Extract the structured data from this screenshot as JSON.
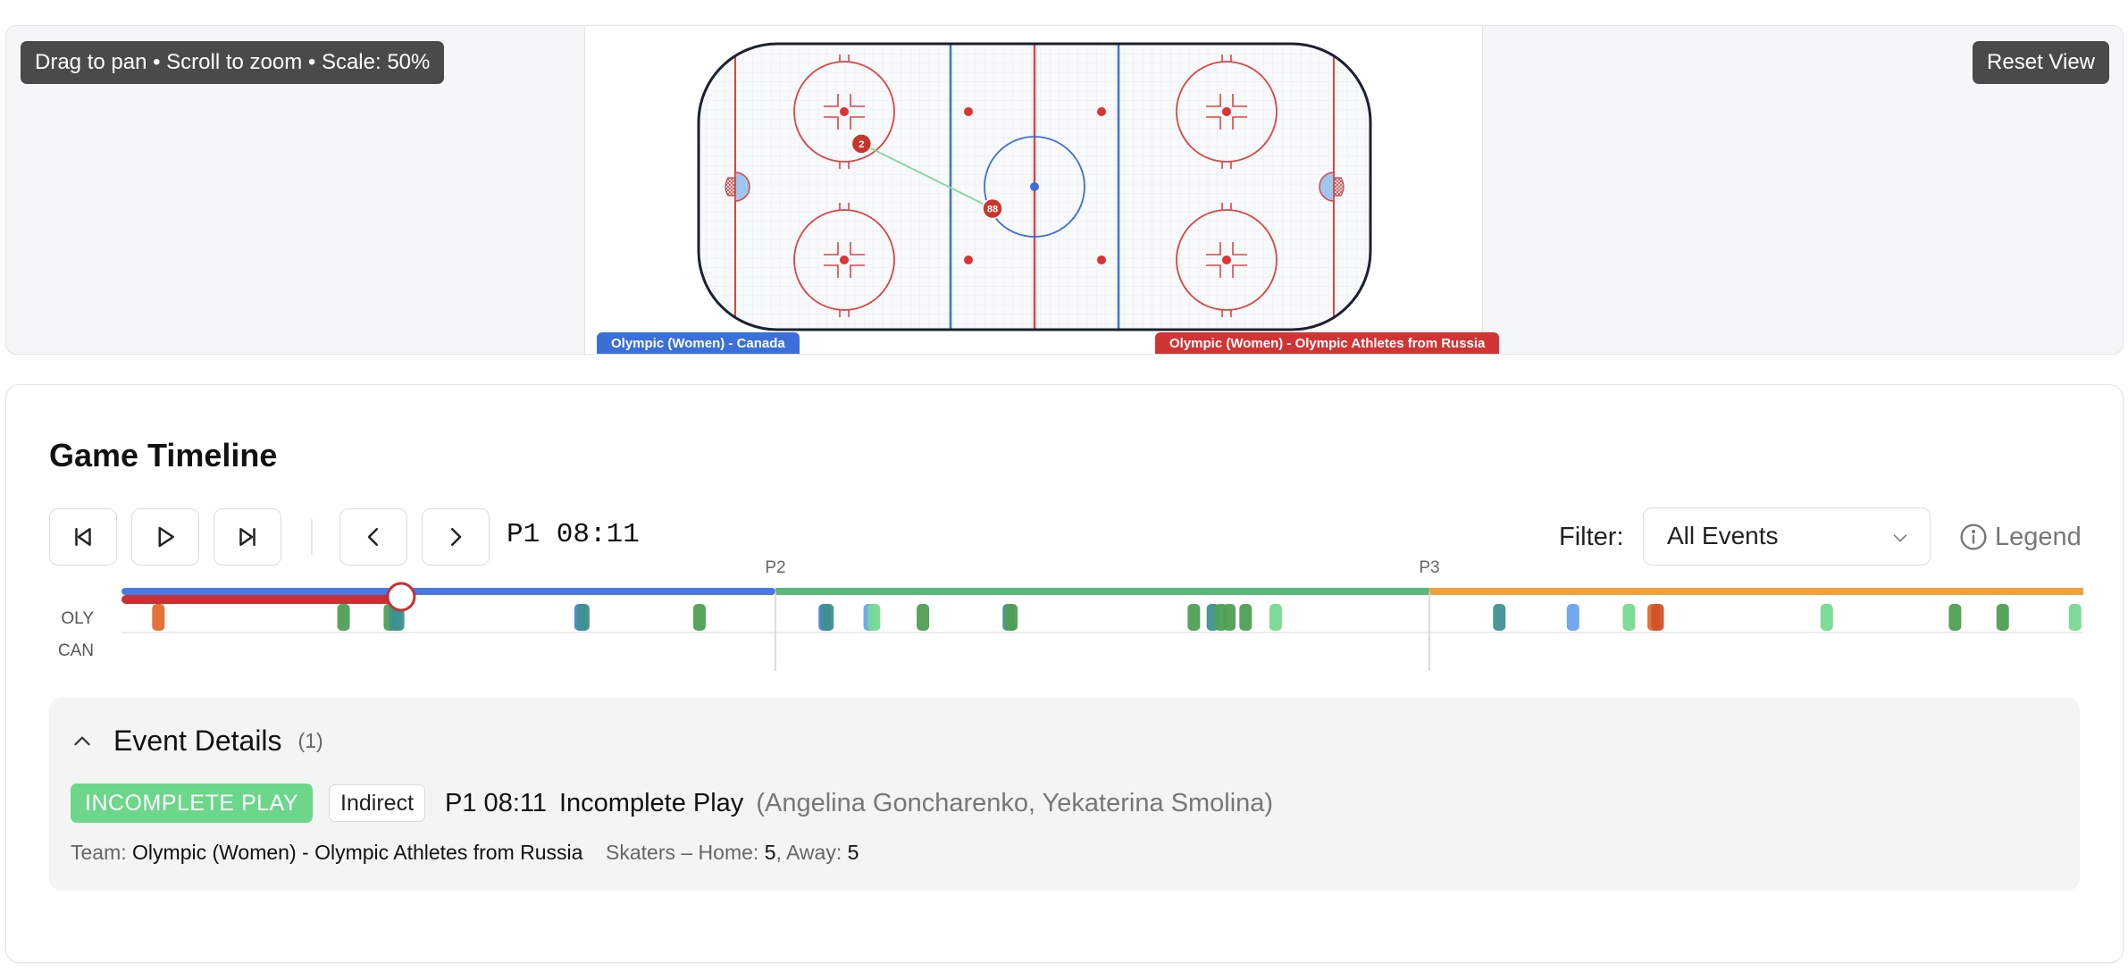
{
  "rink": {
    "hint": "Drag to pan • Scroll to zoom • Scale: 50%",
    "reset_label": "Reset View",
    "home_team_tag": "Olympic (Women) - Canada",
    "away_team_tag": "Olympic (Women) - Olympic Athletes from Russia",
    "players": [
      {
        "number": "2",
        "team": "away",
        "x_ft": -51.5,
        "y_ft": 12.8
      },
      {
        "number": "88",
        "team": "away",
        "x_ft": -12.5,
        "y_ft": -6.5
      }
    ]
  },
  "timeline": {
    "title": "Game Timeline",
    "clock": "P1 08:11",
    "filter_label": "Filter:",
    "filter_value": "All Events",
    "legend_label": "Legend",
    "period_labels": [
      "P2",
      "P3"
    ],
    "row_labels": [
      "OLY",
      "CAN"
    ],
    "progress": 0.1425,
    "period_colors": [
      "#4a78e3",
      "#5cb87a",
      "#efa23b"
    ],
    "events": [
      {
        "t": 0.0188,
        "row": "OLY",
        "color": "#e06a2c"
      },
      {
        "t": 0.1132,
        "row": "OLY",
        "color": "#4f9f54"
      },
      {
        "t": 0.1368,
        "row": "OLY",
        "color": "#4f9f54"
      },
      {
        "t": 0.1396,
        "row": "OLY",
        "color": "#3f9190"
      },
      {
        "t": 0.141,
        "row": "OLY",
        "color": "#3f9190"
      },
      {
        "t": 0.234,
        "row": "OLY",
        "color": "#4a82d0"
      },
      {
        "t": 0.2354,
        "row": "OLY",
        "color": "#3f9190"
      },
      {
        "t": 0.2946,
        "row": "OLY",
        "color": "#4f9f54"
      },
      {
        "t": 0.3585,
        "row": "OLY",
        "color": "#4a82d0"
      },
      {
        "t": 0.3599,
        "row": "OLY",
        "color": "#3f9190"
      },
      {
        "t": 0.3814,
        "row": "OLY",
        "color": "#6aa3ec"
      },
      {
        "t": 0.3836,
        "row": "OLY",
        "color": "#77d98f"
      },
      {
        "t": 0.4085,
        "row": "OLY",
        "color": "#4f9f54"
      },
      {
        "t": 0.4523,
        "row": "OLY",
        "color": "#3f9190"
      },
      {
        "t": 0.4536,
        "row": "OLY",
        "color": "#4f9f54"
      },
      {
        "t": 0.5466,
        "row": "OLY",
        "color": "#4f9f54"
      },
      {
        "t": 0.5563,
        "row": "OLY",
        "color": "#3f9190"
      },
      {
        "t": 0.5605,
        "row": "OLY",
        "color": "#4f9f54"
      },
      {
        "t": 0.5647,
        "row": "OLY",
        "color": "#4f9f54"
      },
      {
        "t": 0.573,
        "row": "OLY",
        "color": "#4f9f54"
      },
      {
        "t": 0.5883,
        "row": "OLY",
        "color": "#77d98f"
      },
      {
        "t": 0.7023,
        "row": "OLY",
        "color": "#3f9190"
      },
      {
        "t": 0.7399,
        "row": "OLY",
        "color": "#6aa3ec"
      },
      {
        "t": 0.7684,
        "row": "OLY",
        "color": "#77d98f"
      },
      {
        "t": 0.781,
        "row": "OLY",
        "color": "#e06a2c"
      },
      {
        "t": 0.783,
        "row": "OLY",
        "color": "#d0522a"
      },
      {
        "t": 0.8692,
        "row": "OLY",
        "color": "#77d98f"
      },
      {
        "t": 0.9346,
        "row": "OLY",
        "color": "#4f9f54"
      },
      {
        "t": 0.9589,
        "row": "OLY",
        "color": "#4f9f54"
      },
      {
        "t": 0.9958,
        "row": "OLY",
        "color": "#77d98f"
      }
    ]
  },
  "details": {
    "title": "Event Details",
    "count": "(1)",
    "type_badge": "INCOMPLETE PLAY",
    "pass_type": "Indirect",
    "time": "P1 08:11",
    "event_name": "Incomplete Play",
    "players": "(Angelina Goncharenko, Yekaterina Smolina)",
    "team_label": "Team:",
    "team_name": "Olympic (Women) - Olympic Athletes from Russia",
    "skaters_label": "Skaters – Home:",
    "skaters_home": "5",
    "away_label": ", Away:",
    "skaters_away": "5"
  }
}
